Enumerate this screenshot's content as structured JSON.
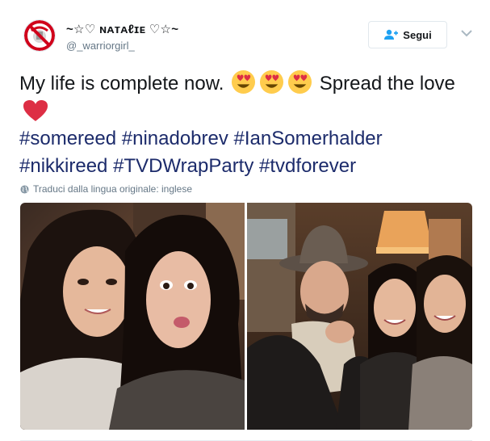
{
  "user": {
    "display_name": "~☆♡ ɴᴀᴛᴀℓɪᴇ ♡☆~",
    "handle": "@_warriorgirl_",
    "avatar_icon": "no-dreams-sign-icon"
  },
  "actions": {
    "follow_label": "Segui",
    "follow_icon": "add-person-icon",
    "menu_icon": "chevron-down-icon"
  },
  "tweet": {
    "text_part1": "My life is complete now.",
    "text_part2": "Spread the love",
    "emojis": [
      "heart-eyes-emoji",
      "heart-eyes-emoji",
      "heart-eyes-emoji",
      "red-heart-emoji"
    ],
    "hashtags": [
      "#somereed",
      "#ninadobrev",
      "#IanSomerhalder",
      "#nikkireed",
      "#TVDWrapParty",
      "#tvdforever"
    ]
  },
  "translate": {
    "label": "Traduci dalla lingua originale: inglese",
    "icon": "globe-icon"
  },
  "colors": {
    "text": "#14171a",
    "secondary": "#657786",
    "hashtag": "#1c2b6b",
    "follow_icon": "#1da1f2",
    "heart": "#dd2e44",
    "emoji_face": "#ffcc4d"
  }
}
